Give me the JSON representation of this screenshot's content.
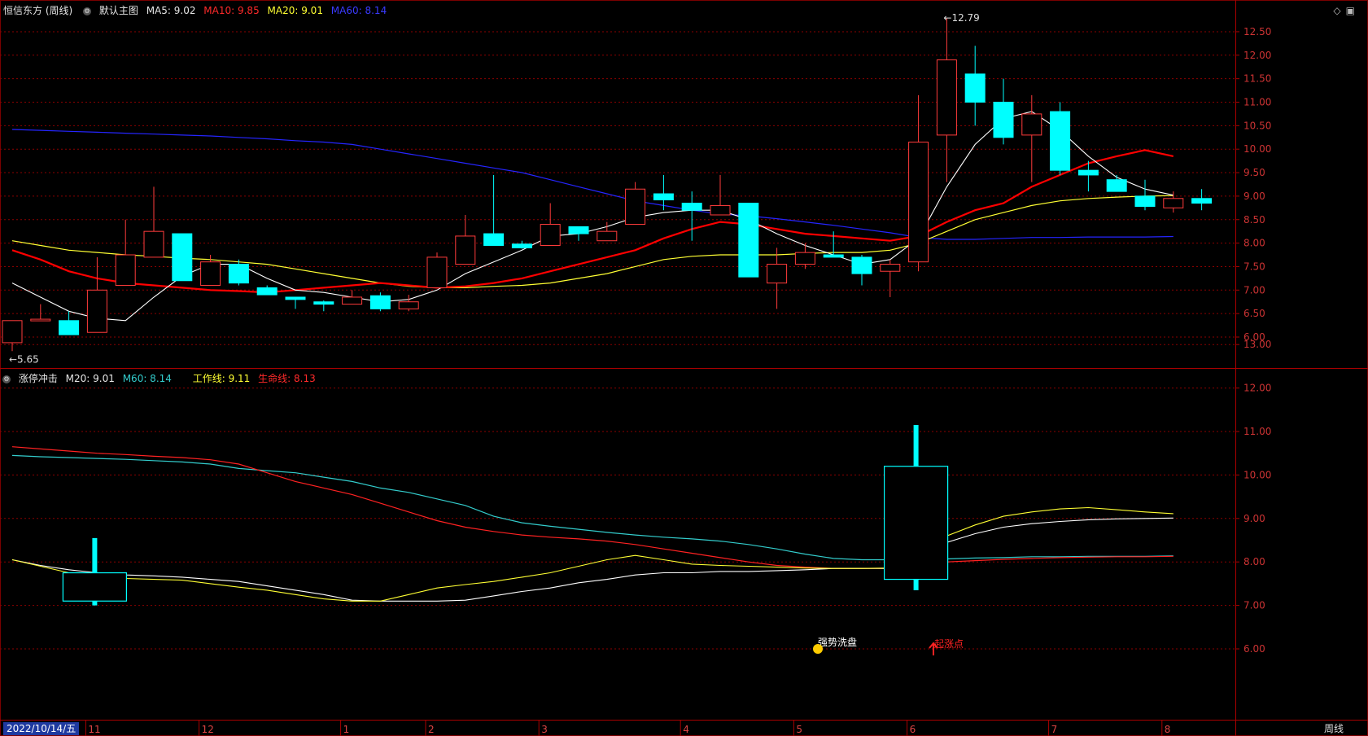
{
  "header_main": {
    "stock": "恒信东方 (周线)",
    "chart_name": "默认主图",
    "ma5": "MA5: 9.02",
    "ma10": "MA10: 9.85",
    "ma20": "MA20: 9.01",
    "ma60": "MA60: 8.14"
  },
  "header_sub": {
    "name": "涨停冲击",
    "m20": "M20: 9.01",
    "m60": "M60: 8.14",
    "work": "工作线: 9.11",
    "life": "生命线: 8.13"
  },
  "icons": [
    "diamond-icon",
    "maximize-icon"
  ],
  "date_label": "2022/10/14/五",
  "period_label": "周线",
  "month_labels": [
    {
      "label": "11",
      "week": 3
    },
    {
      "label": "12",
      "week": 7
    },
    {
      "label": "1",
      "week": 12
    },
    {
      "label": "2",
      "week": 15
    },
    {
      "label": "3",
      "week": 19
    },
    {
      "label": "4",
      "week": 24
    },
    {
      "label": "5",
      "week": 28
    },
    {
      "label": "6",
      "week": 32
    },
    {
      "label": "7",
      "week": 37
    },
    {
      "label": "8",
      "week": 41
    }
  ],
  "main_axis": {
    "ticks": [
      "6.00",
      "6.50",
      "7.00",
      "7.50",
      "8.00",
      "8.50",
      "9.00",
      "9.50",
      "10.00",
      "10.50",
      "11.00",
      "11.50",
      "12.00",
      "12.50"
    ],
    "min": 5.65,
    "max": 12.79
  },
  "sub_axis": {
    "ticks": [
      "6.00",
      "7.00",
      "8.00",
      "9.00",
      "10.00",
      "11.00",
      "12.00",
      "13.00"
    ]
  },
  "annotations": {
    "high": "12.79",
    "low": "5.65",
    "wash": "强势洗盘",
    "start": "起涨点"
  },
  "colors": {
    "up": "#ff3b3b",
    "down": "#00ffff",
    "ma5": "#ffffff",
    "ma10": "#ff0000",
    "ma20": "#ffff33",
    "ma60": "#2525ff",
    "grid": "#8b0000"
  },
  "chart_data": {
    "type": "candlestick",
    "candles": [
      [
        5.88,
        6.35,
        6.35,
        5.7
      ],
      [
        6.38,
        6.38,
        6.7,
        6.35
      ],
      [
        6.35,
        6.05,
        6.55,
        6.05
      ],
      [
        6.1,
        7.0,
        7.7,
        6.1
      ],
      [
        7.1,
        7.75,
        8.5,
        7.1
      ],
      [
        7.7,
        8.25,
        9.2,
        7.7
      ],
      [
        8.2,
        7.2,
        8.2,
        7.2
      ],
      [
        7.1,
        7.6,
        7.75,
        7.1
      ],
      [
        7.55,
        7.15,
        7.65,
        7.1
      ],
      [
        7.05,
        6.9,
        7.1,
        6.9
      ],
      [
        6.85,
        6.8,
        6.85,
        6.6
      ],
      [
        6.75,
        6.7,
        6.78,
        6.55
      ],
      [
        6.7,
        6.85,
        7.0,
        6.7
      ],
      [
        6.88,
        6.6,
        6.95,
        6.55
      ],
      [
        6.6,
        6.75,
        6.9,
        6.55
      ],
      [
        7.05,
        7.7,
        7.8,
        7.05
      ],
      [
        7.55,
        8.15,
        8.6,
        7.55
      ],
      [
        8.2,
        7.95,
        9.45,
        7.95
      ],
      [
        7.98,
        7.9,
        8.05,
        7.88
      ],
      [
        7.95,
        8.4,
        8.85,
        7.95
      ],
      [
        8.35,
        8.2,
        8.35,
        8.05
      ],
      [
        8.05,
        8.25,
        8.45,
        8.05
      ],
      [
        8.4,
        9.15,
        9.3,
        8.4
      ],
      [
        9.05,
        8.92,
        9.45,
        8.7
      ],
      [
        8.85,
        8.7,
        9.1,
        8.05
      ],
      [
        8.6,
        8.8,
        9.45,
        8.6
      ],
      [
        8.85,
        7.28,
        8.85,
        7.28
      ],
      [
        7.15,
        7.55,
        7.9,
        6.6
      ],
      [
        7.55,
        7.8,
        8.0,
        7.45
      ],
      [
        7.75,
        7.7,
        8.25,
        7.7
      ],
      [
        7.7,
        7.35,
        7.75,
        7.1
      ],
      [
        7.4,
        7.55,
        7.65,
        6.85
      ],
      [
        7.6,
        10.15,
        11.15,
        7.4
      ],
      [
        10.3,
        11.9,
        12.79,
        9.3
      ],
      [
        11.6,
        11.0,
        12.2,
        10.5
      ],
      [
        11.0,
        10.25,
        11.5,
        10.1
      ],
      [
        10.3,
        10.75,
        11.15,
        9.3
      ],
      [
        10.8,
        9.55,
        11.0,
        9.45
      ],
      [
        9.55,
        9.45,
        9.75,
        9.1
      ],
      [
        9.35,
        9.1,
        9.45,
        9.1
      ],
      [
        9.0,
        8.78,
        9.35,
        8.7
      ],
      [
        8.75,
        8.95,
        9.1,
        8.65
      ],
      [
        8.95,
        8.85,
        9.15,
        8.7
      ]
    ],
    "ma5": [
      7.15,
      6.85,
      6.55,
      6.4,
      6.35,
      6.85,
      7.3,
      7.55,
      7.55,
      7.25,
      7.0,
      6.95,
      6.85,
      6.75,
      6.8,
      7.0,
      7.35,
      7.6,
      7.85,
      8.15,
      8.2,
      8.35,
      8.55,
      8.65,
      8.7,
      8.7,
      8.5,
      8.2,
      7.95,
      7.75,
      7.55,
      7.65,
      8.1,
      9.2,
      10.1,
      10.65,
      10.8,
      10.4,
      9.85,
      9.4,
      9.15,
      9.02
    ],
    "ma10": [
      7.85,
      7.65,
      7.4,
      7.25,
      7.15,
      7.1,
      7.05,
      7.0,
      6.98,
      6.95,
      7.0,
      7.05,
      7.1,
      7.15,
      7.1,
      7.05,
      7.08,
      7.15,
      7.25,
      7.4,
      7.55,
      7.7,
      7.85,
      8.1,
      8.3,
      8.45,
      8.4,
      8.3,
      8.2,
      8.15,
      8.1,
      8.05,
      8.15,
      8.45,
      8.7,
      8.85,
      9.2,
      9.45,
      9.7,
      9.85,
      9.98,
      9.85
    ],
    "ma20": [
      8.05,
      7.95,
      7.85,
      7.8,
      7.75,
      7.72,
      7.68,
      7.65,
      7.6,
      7.55,
      7.45,
      7.35,
      7.25,
      7.15,
      7.08,
      7.05,
      7.05,
      7.08,
      7.1,
      7.15,
      7.25,
      7.35,
      7.5,
      7.65,
      7.72,
      7.75,
      7.75,
      7.75,
      7.78,
      7.8,
      7.8,
      7.85,
      8.0,
      8.25,
      8.5,
      8.65,
      8.8,
      8.9,
      8.95,
      8.98,
      9.0,
      9.01
    ],
    "ma60": [
      10.42,
      10.4,
      10.38,
      10.36,
      10.34,
      10.32,
      10.3,
      10.28,
      10.25,
      10.22,
      10.18,
      10.15,
      10.1,
      10.0,
      9.9,
      9.8,
      9.7,
      9.6,
      9.5,
      9.35,
      9.2,
      9.05,
      8.9,
      8.8,
      8.7,
      8.62,
      8.58,
      8.52,
      8.45,
      8.38,
      8.3,
      8.22,
      8.12,
      8.08,
      8.08,
      8.1,
      8.12,
      8.12,
      8.13,
      8.13,
      8.13,
      8.14
    ],
    "sub_lines": {
      "m20": [
        8.05,
        7.92,
        7.82,
        7.75,
        7.7,
        7.68,
        7.65,
        7.6,
        7.55,
        7.45,
        7.35,
        7.25,
        7.12,
        7.1,
        7.1,
        7.1,
        7.12,
        7.22,
        7.32,
        7.4,
        7.52,
        7.6,
        7.7,
        7.75,
        7.75,
        7.78,
        7.78,
        7.8,
        7.82,
        7.85,
        7.85,
        7.85,
        8.1,
        8.45,
        8.65,
        8.8,
        8.88,
        8.93,
        8.97,
        8.99,
        9.0,
        9.01
      ],
      "work": [
        8.05,
        7.9,
        7.75,
        7.68,
        7.62,
        7.6,
        7.58,
        7.5,
        7.42,
        7.35,
        7.25,
        7.15,
        7.1,
        7.1,
        7.25,
        7.4,
        7.48,
        7.55,
        7.65,
        7.75,
        7.9,
        8.05,
        8.15,
        8.05,
        7.95,
        7.92,
        7.9,
        7.88,
        7.86,
        7.85,
        7.85,
        7.86,
        8.3,
        8.6,
        8.85,
        9.05,
        9.15,
        9.22,
        9.25,
        9.2,
        9.15,
        9.11
      ],
      "m60": [
        10.45,
        10.42,
        10.4,
        10.38,
        10.36,
        10.33,
        10.3,
        10.25,
        10.15,
        10.1,
        10.05,
        9.95,
        9.85,
        9.7,
        9.6,
        9.45,
        9.3,
        9.05,
        8.9,
        8.82,
        8.75,
        8.68,
        8.62,
        8.57,
        8.53,
        8.48,
        8.4,
        8.3,
        8.18,
        8.08,
        8.05,
        8.05,
        8.05,
        8.07,
        8.09,
        8.1,
        8.12,
        8.12,
        8.13,
        8.13,
        8.13,
        8.14
      ],
      "life": [
        10.65,
        10.6,
        10.55,
        10.5,
        10.47,
        10.43,
        10.4,
        10.35,
        10.25,
        10.05,
        9.85,
        9.7,
        9.55,
        9.35,
        9.15,
        8.95,
        8.8,
        8.7,
        8.62,
        8.57,
        8.53,
        8.48,
        8.4,
        8.3,
        8.2,
        8.1,
        8.0,
        7.92,
        7.88,
        7.85,
        7.85,
        7.85,
        7.95,
        8.0,
        8.03,
        8.06,
        8.08,
        8.1,
        8.11,
        8.12,
        8.12,
        8.13
      ]
    },
    "sub_candles": [
      [
        3,
        7.75,
        7.1,
        8.55,
        7.0
      ],
      [
        32,
        7.6,
        10.2,
        11.15,
        7.35
      ]
    ]
  }
}
